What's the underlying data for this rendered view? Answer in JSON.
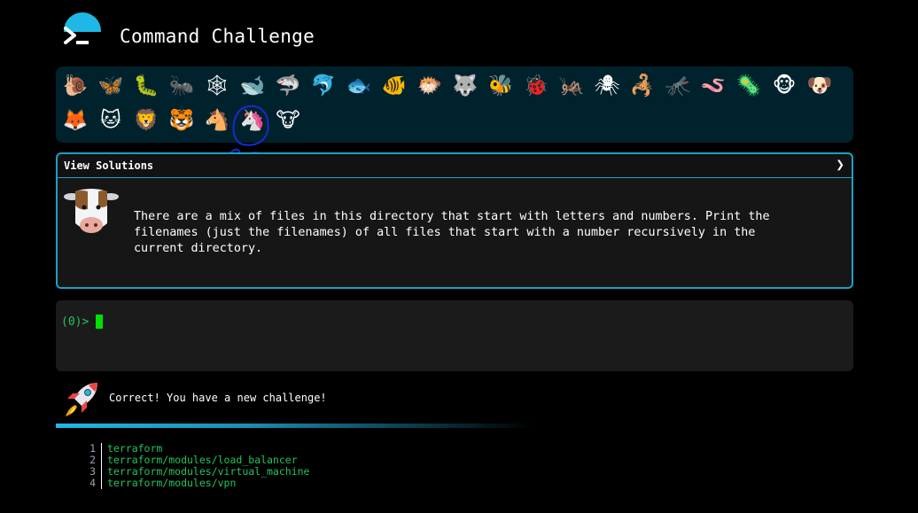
{
  "header": {
    "title": "Command Challenge",
    "logo_icon": "terminal-prompt-icon",
    "accent": "#1fb8e6"
  },
  "animals": {
    "row1": [
      "🐌",
      "🦋",
      "🐛",
      "🐜",
      "🕸",
      "🐋",
      "🦈",
      "🐬",
      "🐟",
      "🐠",
      "🐡",
      "🐺",
      "🐝",
      "🐞",
      "🦗",
      "🕷",
      "🦂",
      "🦟",
      "🪱",
      "🦠",
      "🐵",
      "🐶"
    ],
    "row2": [
      "🦊",
      "🐱",
      "🦁",
      "🐯",
      "🐴",
      "🦄",
      "🐮"
    ],
    "current_index_row2": 5
  },
  "solutions": {
    "label": "View Solutions",
    "chevron": "❯",
    "avatar": "cow-icon",
    "challenge": "There are a mix of files in this directory that start with letters and numbers. Print the\nfilenames (just the filenames) of all files that start with a number recursively in the\ncurrent directory."
  },
  "terminal": {
    "prompt": "(0)>",
    "cursor_color": "#00e000"
  },
  "status": {
    "icon": "rocket-icon",
    "message": "Correct! You have a new challenge!"
  },
  "output": {
    "lines": [
      {
        "num": "1",
        "text": "terraform"
      },
      {
        "num": "2",
        "text": "terraform/modules/load_balancer"
      },
      {
        "num": "3",
        "text": "terraform/modules/virtual_machine"
      },
      {
        "num": "4",
        "text": "terraform/modules/vpn"
      }
    ]
  }
}
